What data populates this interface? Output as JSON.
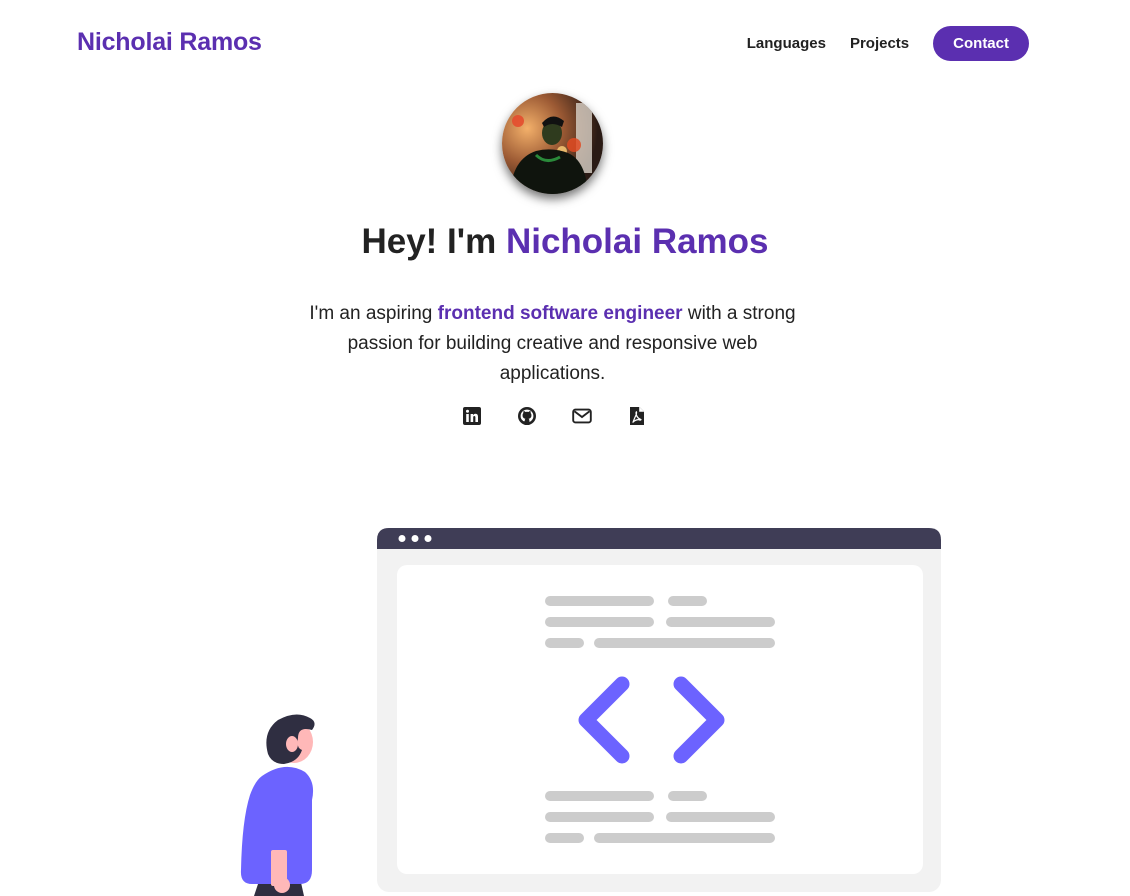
{
  "header": {
    "brand": "Nicholai Ramos",
    "nav": {
      "languages": "Languages",
      "projects": "Projects",
      "contact": "Contact"
    }
  },
  "hero": {
    "greeting": "Hey! I'm ",
    "name": "Nicholai Ramos",
    "intro_before": "I'm an aspiring ",
    "intro_highlight": "frontend software engineer",
    "intro_after": " with a strong passion for building creative and responsive web applications."
  },
  "socials": [
    {
      "icon": "linkedin-icon"
    },
    {
      "icon": "github-icon"
    },
    {
      "icon": "email-icon"
    },
    {
      "icon": "pdf-resume-icon"
    }
  ],
  "colors": {
    "accent": "#5b2fb0",
    "illustration_purple": "#6c63ff",
    "window_bar": "#3f3d56",
    "window_body": "#f2f2f2",
    "placeholder_lines": "#cccccc"
  }
}
